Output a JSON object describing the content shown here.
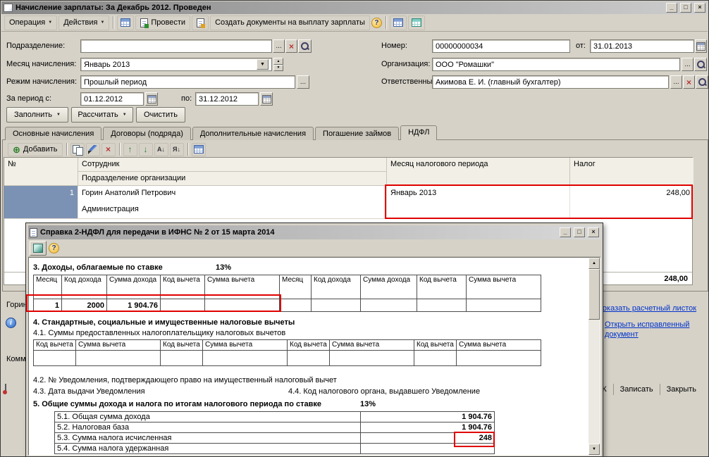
{
  "icons": {
    "caret_down": "▼",
    "caret_up": "▲",
    "ellipsis": "...",
    "clear_x": "×",
    "minimize": "_",
    "maximize": "□",
    "close": "×",
    "help": "?",
    "add_plus": "⊕",
    "delete_x": "×",
    "arrow_up": "↑",
    "arrow_down": "↓",
    "sort_asc": "А↓",
    "sort_desc": "Я↓",
    "info": "i",
    "scroll_up": "▲",
    "scroll_down": "▼"
  },
  "main_window": {
    "title": "Начисление зарплаты: За Декабрь 2012. Проведен",
    "toolbar": {
      "operation": "Операция",
      "actions": "Действия",
      "post": "Провести",
      "create_docs": "Создать документы на выплату зарплаты"
    },
    "form": {
      "department": {
        "label": "Подразделение:",
        "value": ""
      },
      "accrual_month": {
        "label": "Месяц начисления:",
        "value": "Январь 2013"
      },
      "accrual_mode": {
        "label": "Режим начисления:",
        "value": "Прошлый период"
      },
      "period_from": {
        "label": "За период с:",
        "value": "01.12.2012"
      },
      "period_to": {
        "label": "по:",
        "value": "31.12.2012"
      },
      "number": {
        "label": "Номер:",
        "value": "00000000034"
      },
      "doc_date": {
        "label": "от:",
        "value": "31.01.2013"
      },
      "organization": {
        "label": "Организация:",
        "value": "ООО \"Ромашки\""
      },
      "responsible": {
        "label": "Ответственный:",
        "value": "Акимова Е. И. (главный бухгалтер)"
      }
    },
    "buttons": {
      "fill": "Заполнить",
      "calculate": "Рассчитать",
      "clear": "Очистить"
    },
    "tabs": [
      {
        "label": "Основные начисления"
      },
      {
        "label": "Договоры (подряда)"
      },
      {
        "label": "Дополнительные начисления"
      },
      {
        "label": "Погашение займов"
      },
      {
        "label": "НДФЛ"
      }
    ],
    "grid": {
      "add": "Добавить",
      "headers": {
        "num": "№",
        "employee": "Сотрудник",
        "department": "Подразделение организации",
        "tax_month": "Месяц налогового периода",
        "tax": "Налог"
      },
      "row": {
        "num": "1",
        "employee": "Горин Анатолий Петрович",
        "department": "Администрация",
        "tax_month": "Январь 2013",
        "tax": "248,00"
      },
      "total": "248,00"
    },
    "bottom": {
      "selected_employee": "Горин Анатолий Петрович",
      "payslip_link": "Показать расчетный листок",
      "corrected_link": "Открыть исправленный документ",
      "comment_label": "Комментарий:"
    },
    "footer": {
      "ok": "ОК",
      "save": "Записать",
      "close": "Закрыть"
    }
  },
  "dialog": {
    "title": "Справка 2-НДФЛ для передачи в ИФНС № 2 от 15 марта 2014",
    "section3": {
      "heading": "3. Доходы, облагаемые по ставке",
      "rate": "13%",
      "columns": [
        "Месяц",
        "Код дохода",
        "Сумма дохода",
        "Код вычета",
        "Сумма вычета",
        "Месяц",
        "Код дохода",
        "Сумма дохода",
        "Код вычета",
        "Сумма вычета"
      ],
      "row": [
        "1",
        "2000",
        "1 904.76",
        "",
        "",
        "",
        "",
        "",
        "",
        ""
      ]
    },
    "section4": {
      "heading": "4. Стандартные, социальные и имущественные налоговые вычеты",
      "sub1": "4.1. Суммы предоставленных налогоплательщику налоговых вычетов",
      "columns": [
        "Код вычета",
        "Сумма вычета",
        "Код вычета",
        "Сумма вычета",
        "Код вычета",
        "Сумма вычета",
        "Код вычета",
        "Сумма вычета"
      ],
      "sub2": "4.2. № Уведомления, подтверждающего право на имущественный налоговый вычет",
      "sub3": "4.3. Дата выдачи Уведомления",
      "sub4": "4.4. Код налогового органа, выдавшего Уведомление"
    },
    "section5": {
      "heading": "5. Общие суммы дохода и налога по итогам налогового периода по ставке",
      "rate": "13%",
      "rows": [
        {
          "label": "5.1. Общая сумма дохода",
          "value": "1 904.76"
        },
        {
          "label": "5.2. Налоговая база",
          "value": "1 904.76"
        },
        {
          "label": "5.3. Сумма налога исчисленная",
          "value": "248"
        },
        {
          "label": "5.4. Сумма налога удержанная",
          "value": ""
        }
      ]
    }
  }
}
